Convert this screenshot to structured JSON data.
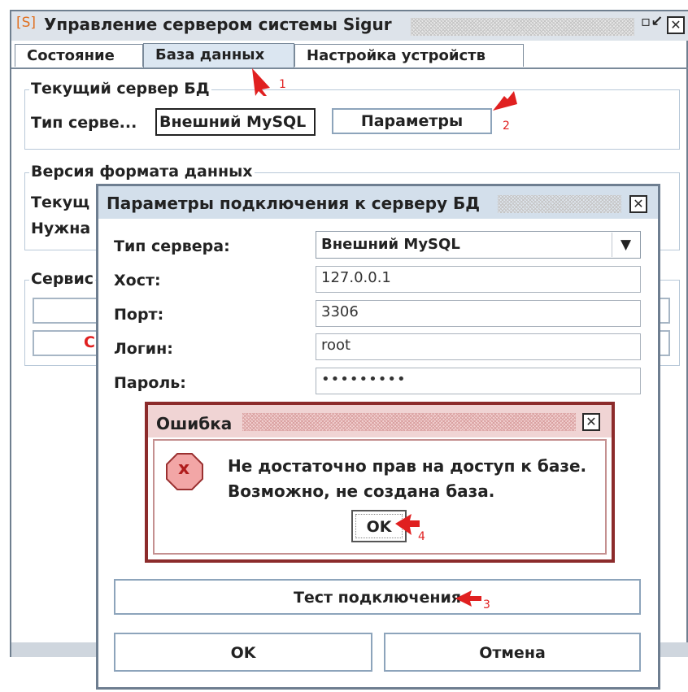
{
  "window": {
    "icon_text": "[S]",
    "title": "Управление сервером системы Sigur",
    "minimize_glyph": "▫↙",
    "close_glyph": "✕"
  },
  "tabs": [
    {
      "label": "Состояние",
      "active": false
    },
    {
      "label": "База данных",
      "active": true
    },
    {
      "label": "Настройка устройств",
      "active": false
    }
  ],
  "current_server": {
    "legend": "Текущий сервер БД",
    "type_label": "Тип серве...",
    "type_value": "Внешний MySQL",
    "params_button": "Параметры"
  },
  "format_version": {
    "legend": "Версия формата данных",
    "current_label": "Текущ",
    "needed_label": "Нужна"
  },
  "service": {
    "legend": "Сервис",
    "button2_visible_char": "С"
  },
  "conn_dialog": {
    "title": "Параметры подключения к серверу БД",
    "close_glyph": "✕",
    "fields": [
      {
        "label": "Тип сервера:",
        "value": "Внешний MySQL"
      },
      {
        "label": "Хост:",
        "value": "127.0.0.1"
      },
      {
        "label": "Порт:",
        "value": "3306"
      },
      {
        "label": "Логин:",
        "value": "root"
      },
      {
        "label": "Пароль:",
        "value": "•••••••••"
      }
    ],
    "dropdown_glyph": "▼",
    "test_button": "Тест подключения",
    "ok_button": "OK",
    "cancel_button": "Отмена"
  },
  "error_dialog": {
    "title": "Ошибка",
    "close_glyph": "✕",
    "icon_glyph": "x",
    "message_line1": "Не достаточно прав на доступ к базе.",
    "message_line2": "Возможно, не создана база.",
    "ok_button": "OK"
  },
  "annotations": {
    "n1": "1",
    "n2": "2",
    "n3": "3",
    "n4": "4",
    "color": "#e02020"
  }
}
